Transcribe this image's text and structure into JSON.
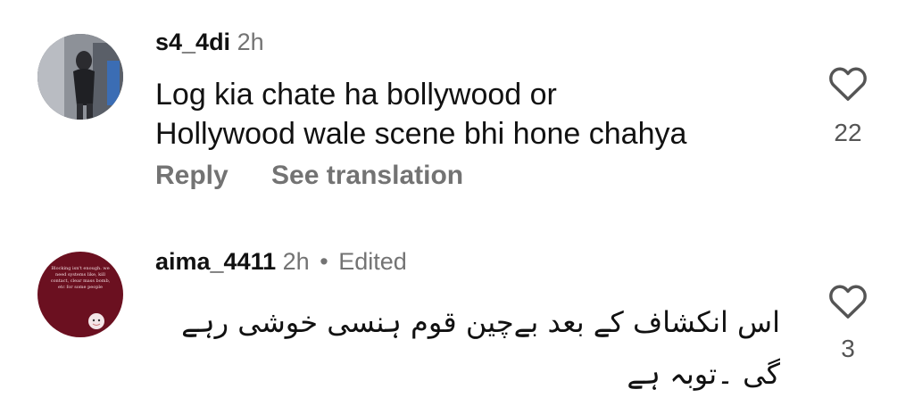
{
  "comments": [
    {
      "username": "s4_4di",
      "time": "2h",
      "text_line1": "Log kia chate ha bollywood or",
      "text_line2": "Hollywood wale scene bhi hone chahya",
      "reply_label": "Reply",
      "translation_label": "See translation",
      "likes": "22",
      "avatar_colors": {
        "primary": "#3a3d44",
        "secondary": "#c9ccd1"
      }
    },
    {
      "username": "aima_4411",
      "time": "2h",
      "separator": "•",
      "edited_label": "Edited",
      "text_line1": "اس انکشاف کے بعد بےچین قوم ہنسی خوشی رہے",
      "text_line2": "گی ۔توبہ ہے",
      "likes": "3",
      "avatar_text": "Blocking isn't enough. we need systems like, kill contact, clear mass bomb, etc for some people",
      "avatar_colors": {
        "primary": "#6b1020"
      }
    }
  ],
  "colors": {
    "muted": "#737373",
    "text": "#111111",
    "icon": "#555555"
  },
  "icons": {
    "like": "heart-outline-icon"
  }
}
